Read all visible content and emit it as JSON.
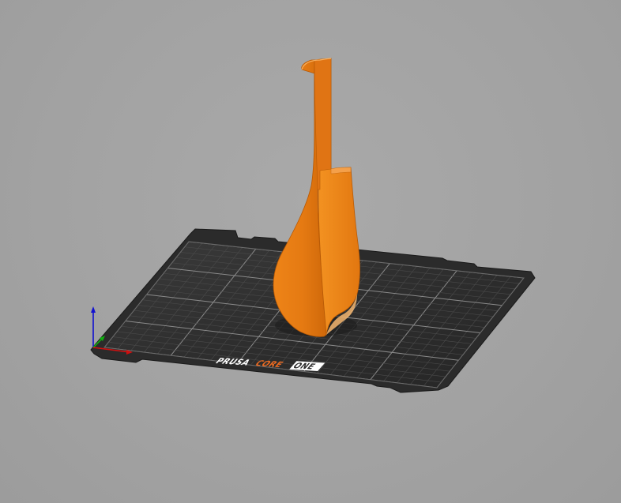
{
  "bed": {
    "brand_word1": "PRUSA",
    "brand_word2": "CORE",
    "brand_word3": "ONE",
    "colors": {
      "plate": "#2b2b2b",
      "plate_edge": "#1f1f1f",
      "grid_minor": "#4a4a4a",
      "grid_major": "#8a8a8a",
      "brand_white": "#ffffff",
      "brand_orange": "#ed6b21"
    }
  },
  "model": {
    "icon": "vase-model",
    "colors": {
      "light": "#f0861a",
      "mid": "#df7310",
      "dark": "#c45f08"
    }
  },
  "axes": {
    "icon": "axes-gizmo-icon",
    "colors": {
      "x": "#d01010",
      "y": "#10b010",
      "z": "#1010d0"
    }
  }
}
